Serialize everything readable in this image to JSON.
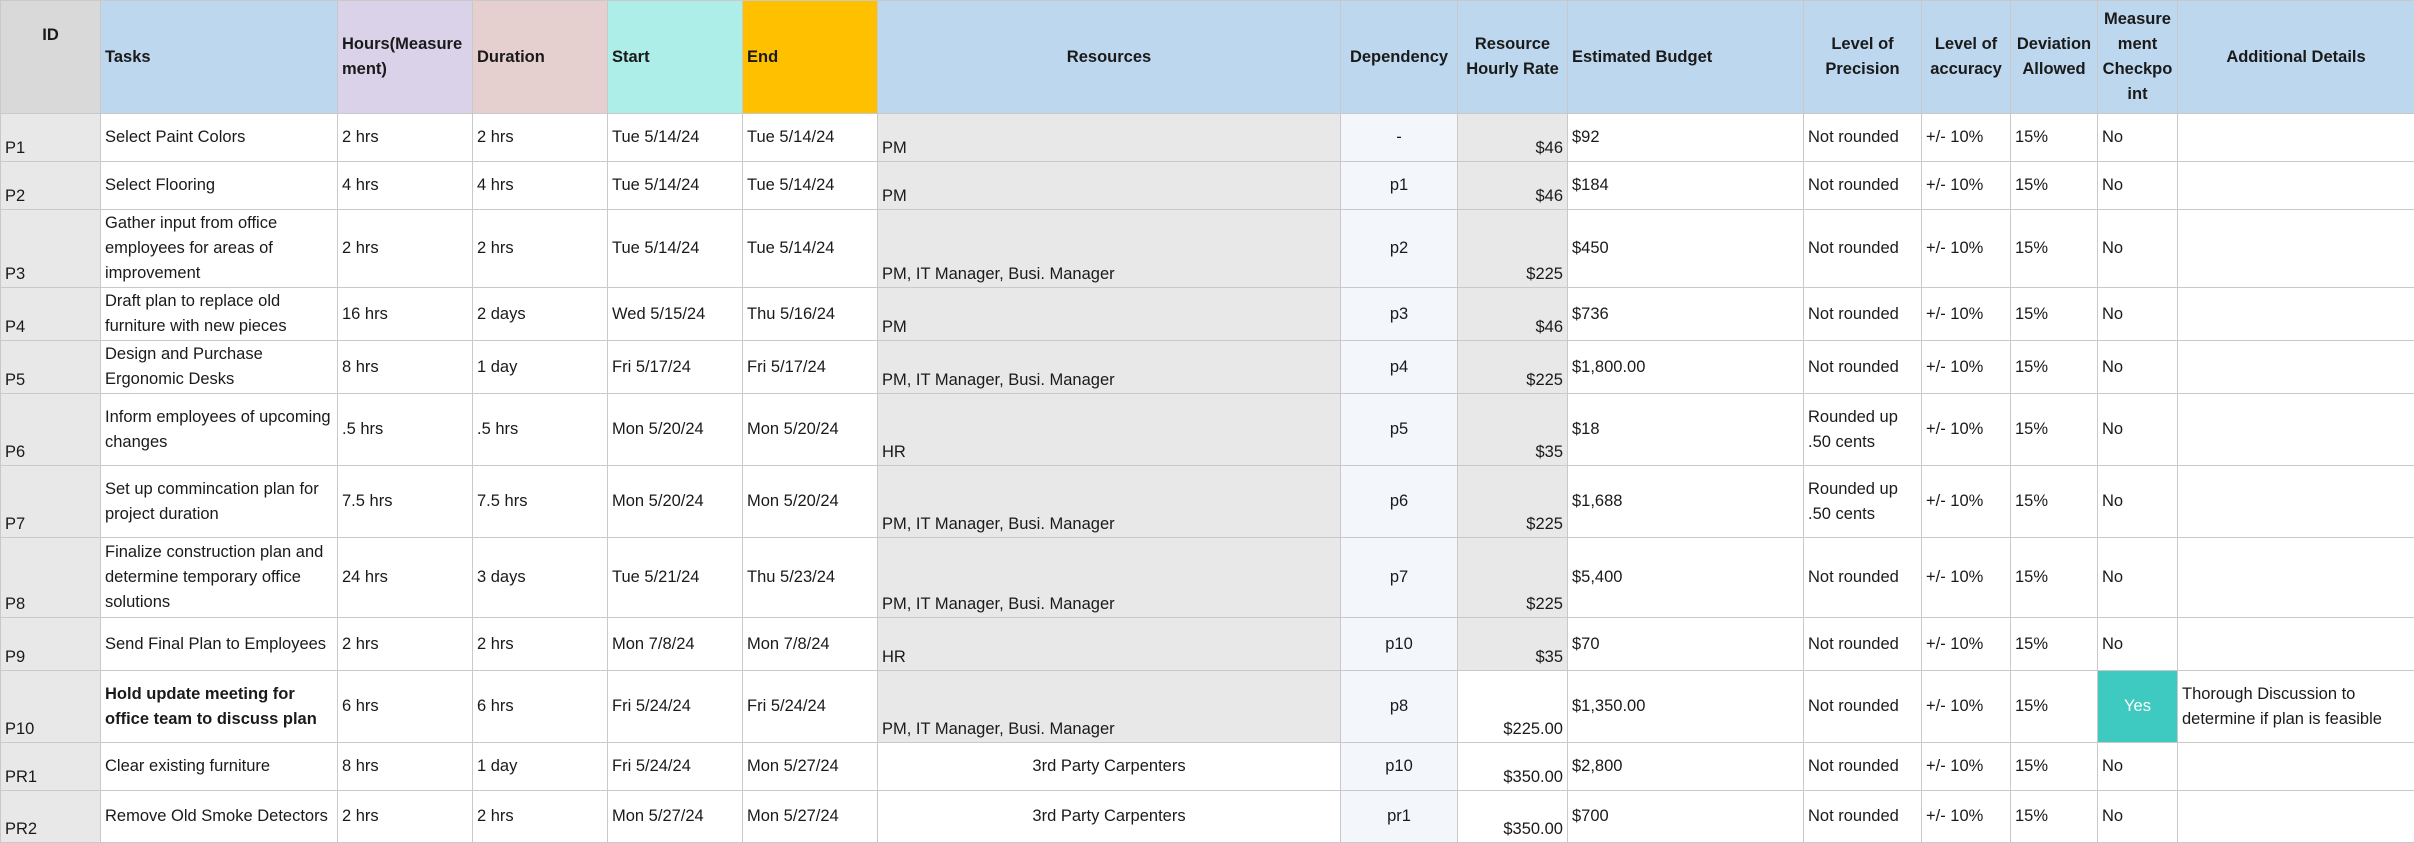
{
  "headers": {
    "id": "ID",
    "tasks": "Tasks",
    "hours": "Hours(Measurement)",
    "duration": "Duration",
    "start": "Start",
    "end": "End",
    "resources": "Resources",
    "dependency": "Dependency",
    "rate": "Resource Hourly Rate",
    "budget": "Estimated Budget",
    "precision": "Level of Precision",
    "accuracy": "Level of accuracy",
    "deviation": "Deviation Allowed",
    "checkpoint": "Measurement Checkpoint",
    "details": "Additional Details"
  },
  "rows": [
    {
      "id": "P1",
      "task": "Select Paint Colors",
      "hours": "2 hrs",
      "duration": "2 hrs",
      "start": "Tue 5/14/24",
      "end": "Tue 5/14/24",
      "resources": "PM",
      "dependency": "-",
      "rate": "$46",
      "budget": "$92",
      "precision": "Not rounded",
      "accuracy": "+/- 10%",
      "deviation": "15%",
      "checkpoint": "No",
      "details": ""
    },
    {
      "id": "P2",
      "task": "Select Flooring",
      "hours": "4 hrs",
      "duration": "4 hrs",
      "start": "Tue 5/14/24",
      "end": "Tue 5/14/24",
      "resources": "PM",
      "dependency": "p1",
      "rate": "$46",
      "budget": "$184",
      "precision": "Not rounded",
      "accuracy": "+/- 10%",
      "deviation": "15%",
      "checkpoint": "No",
      "details": ""
    },
    {
      "id": "P3",
      "task": "Gather input from office employees for areas of improvement",
      "hours": "2 hrs",
      "duration": "2 hrs",
      "start": "Tue 5/14/24",
      "end": "Tue 5/14/24",
      "resources": "PM, IT  Manager, Busi. Manager",
      "dependency": "p2",
      "rate": "$225",
      "budget": "$450",
      "precision": "Not rounded",
      "accuracy": "+/- 10%",
      "deviation": "15%",
      "checkpoint": "No",
      "details": ""
    },
    {
      "id": "P4",
      "task": "Draft plan to replace old furniture with new pieces",
      "hours": "16 hrs",
      "duration": "2 days",
      "start": "Wed 5/15/24",
      "end": "Thu 5/16/24",
      "resources": "PM",
      "dependency": "p3",
      "rate": "$46",
      "budget": "$736",
      "precision": "Not rounded",
      "accuracy": "+/- 10%",
      "deviation": "15%",
      "checkpoint": "No",
      "details": ""
    },
    {
      "id": "P5",
      "task": "Design and Purchase Ergonomic Desks",
      "hours": "8 hrs",
      "duration": "1 day",
      "start": "Fri 5/17/24",
      "end": "Fri 5/17/24",
      "resources": "PM, IT  Manager, Busi. Manager",
      "dependency": "p4",
      "rate": "$225",
      "budget": "$1,800.00",
      "precision": "Not rounded",
      "accuracy": "+/- 10%",
      "deviation": "15%",
      "checkpoint": "No",
      "details": ""
    },
    {
      "id": "P6",
      "task": "Inform employees of upcoming changes",
      "hours": ".5 hrs",
      "duration": ".5 hrs",
      "start": "Mon 5/20/24",
      "end": "Mon 5/20/24",
      "resources": "HR",
      "dependency": "p5",
      "rate": "$35",
      "budget": "$18",
      "precision": "Rounded up .50 cents",
      "accuracy": "+/- 10%",
      "deviation": "15%",
      "checkpoint": "No",
      "details": ""
    },
    {
      "id": "P7",
      "task": "Set up commincation plan for project duration",
      "hours": "7.5 hrs",
      "duration": "7.5 hrs",
      "start": "Mon 5/20/24",
      "end": "Mon 5/20/24",
      "resources": "PM, IT  Manager, Busi. Manager",
      "dependency": "p6",
      "rate": "$225",
      "budget": "$1,688",
      "precision": "Rounded up .50 cents",
      "accuracy": "+/- 10%",
      "deviation": "15%",
      "checkpoint": "No",
      "details": ""
    },
    {
      "id": "P8",
      "task": "Finalize construction plan and determine temporary office solutions",
      "hours": "24 hrs",
      "duration": "3 days",
      "start": "Tue 5/21/24",
      "end": "Thu 5/23/24",
      "resources": "PM, IT  Manager, Busi. Manager",
      "dependency": "p7",
      "rate": "$225",
      "budget": "$5,400",
      "precision": "Not rounded",
      "accuracy": "+/- 10%",
      "deviation": "15%",
      "checkpoint": "No",
      "details": ""
    },
    {
      "id": "P9",
      "task": "Send Final Plan to Employees",
      "hours": "2 hrs",
      "duration": "2 hrs",
      "start": "Mon 7/8/24",
      "end": "Mon 7/8/24",
      "resources": "HR",
      "dependency": "p10",
      "rate": "$35",
      "budget": "$70",
      "precision": "Not rounded",
      "accuracy": "+/- 10%",
      "deviation": "15%",
      "checkpoint": "No",
      "details": ""
    },
    {
      "id": "P10",
      "task": "Hold update meeting for office team to discuss plan",
      "hours": "6 hrs",
      "duration": "6 hrs",
      "start": "Fri 5/24/24",
      "end": "Fri 5/24/24",
      "resources": "PM, IT  Manager, Busi. Manager",
      "dependency": "p8",
      "rate": "$225.00",
      "budget": "$1,350.00",
      "precision": "Not rounded",
      "accuracy": "+/- 10%",
      "deviation": "15%",
      "checkpoint": "Yes",
      "details": "Thorough Discussion to determine if plan is feasible"
    },
    {
      "id": "PR1",
      "task": "Clear existing furniture",
      "hours": "8 hrs",
      "duration": "1 day",
      "start": "Fri 5/24/24",
      "end": "Mon 5/27/24",
      "resources": "3rd Party Carpenters",
      "dependency": "p10",
      "rate": "$350.00",
      "budget": "$2,800",
      "precision": "Not rounded",
      "accuracy": "+/- 10%",
      "deviation": "15%",
      "checkpoint": "No",
      "details": ""
    },
    {
      "id": "PR2",
      "task": "Remove Old Smoke Detectors",
      "hours": "2 hrs",
      "duration": "2 hrs",
      "start": "Mon 5/27/24",
      "end": "Mon 5/27/24",
      "resources": "3rd Party Carpenters",
      "dependency": "pr1",
      "rate": "$350.00",
      "budget": "$700",
      "precision": "Not rounded",
      "accuracy": "+/- 10%",
      "deviation": "15%",
      "checkpoint": "No",
      "details": ""
    }
  ]
}
